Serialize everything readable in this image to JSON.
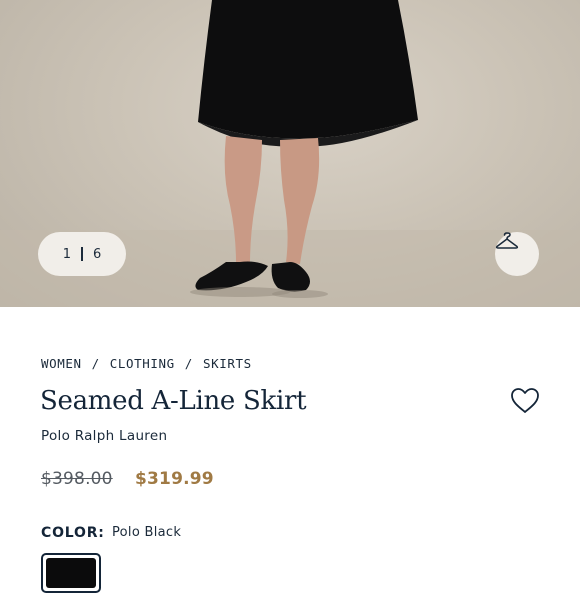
{
  "gallery": {
    "current": "1",
    "total": "6"
  },
  "breadcrumb": {
    "items": [
      "WOMEN",
      "CLOTHING",
      "SKIRTS"
    ],
    "separator": "/"
  },
  "product": {
    "title": "Seamed A-Line Skirt",
    "brand": "Polo Ralph Lauren",
    "price_original": "$398.00",
    "price_sale": "$319.99"
  },
  "color": {
    "label": "COLOR:",
    "selected": "Polo Black",
    "swatch_hex": "#0b0b0c"
  },
  "theme": {
    "text": "#142538",
    "sale_price": "#a07a44"
  },
  "icons": {
    "wishlist": "heart-icon",
    "try_on": "hanger-icon"
  }
}
